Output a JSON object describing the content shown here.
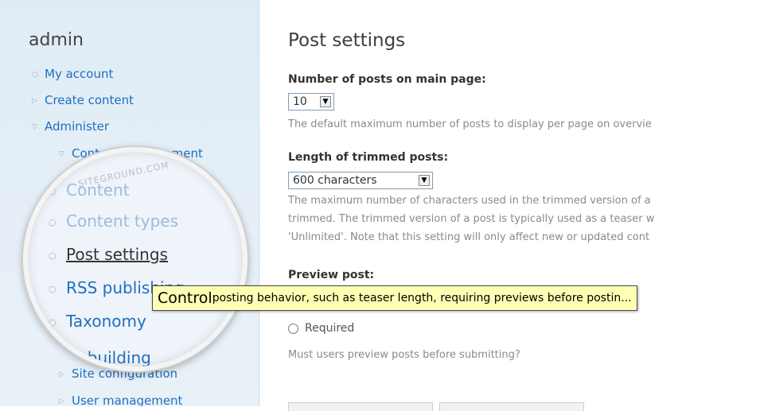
{
  "sidebar": {
    "user": "admin",
    "items": [
      {
        "label": "My account",
        "bullet": "○"
      },
      {
        "label": "Create content",
        "bullet": "▷"
      },
      {
        "label": "Administer",
        "bullet": "▽"
      },
      {
        "label": "Content management",
        "bullet": "▽"
      }
    ],
    "bottom_items": [
      {
        "label": "Site configuration",
        "bullet": "▷"
      },
      {
        "label": "User management",
        "bullet": "▷"
      }
    ]
  },
  "magnifier": {
    "watermark": "SITEGROUND.COM",
    "items": [
      {
        "label": "Content",
        "bullet": "○"
      },
      {
        "label": "Content types",
        "bullet": "○"
      },
      {
        "label": "Post settings",
        "bullet": "○"
      },
      {
        "label": "RSS publishing",
        "bullet": "○"
      },
      {
        "label": "Taxonomy",
        "bullet": "○"
      },
      {
        "label": "Site building",
        "bullet": "▷"
      }
    ]
  },
  "main": {
    "title": "Post settings",
    "posts_per_page": {
      "label": "Number of posts on main page:",
      "value": "10",
      "description": "The default maximum number of posts to display per page on overvie"
    },
    "trim_length": {
      "label": "Length of trimmed posts:",
      "value": "600 characters",
      "description_lines": [
        "The maximum number of characters used in the trimmed version of a",
        "trimmed. The trimmed version of a post is typically used as a teaser w",
        "'Unlimited'. Note that this setting will only affect new or updated cont"
      ]
    },
    "preview": {
      "label": "Preview post:",
      "option_required": "Required",
      "description": "Must users preview posts before submitting?"
    }
  },
  "tooltip": {
    "first_word": "Control",
    "rest": " posting behavior, such as teaser length, requiring previews before postin..."
  },
  "colors": {
    "link": "#1f6ec1",
    "sidebar_bg": "#e3edf6",
    "tooltip_bg": "#ffffb4"
  }
}
